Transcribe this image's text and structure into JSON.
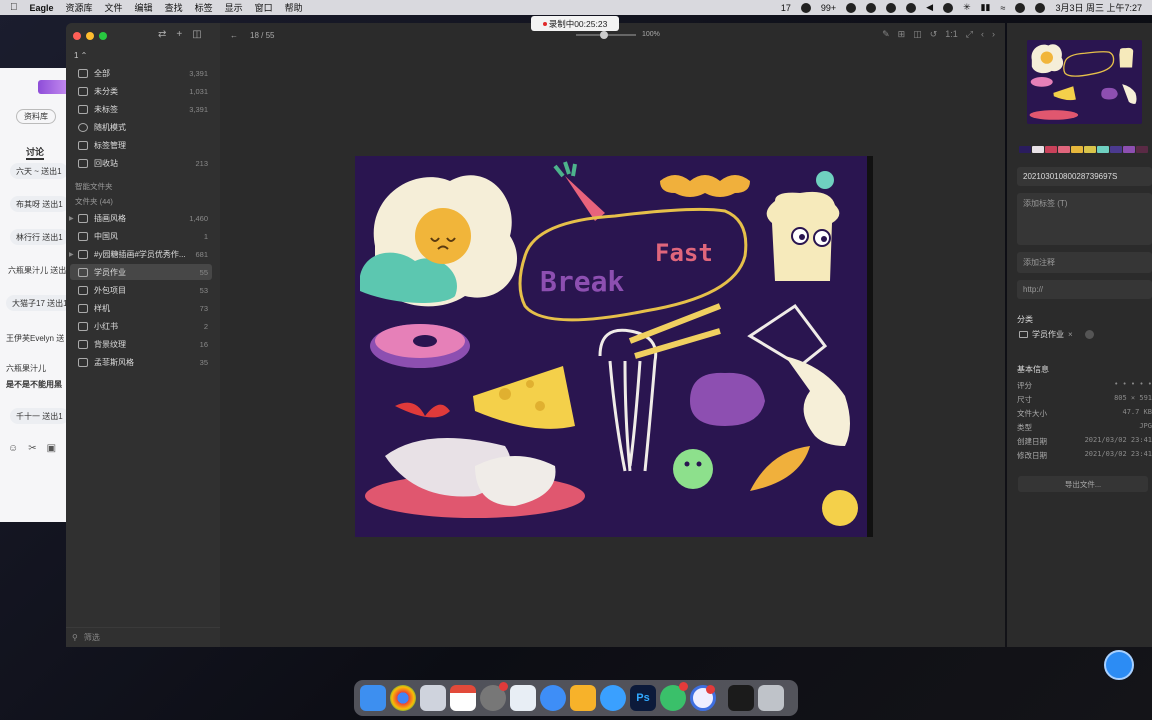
{
  "menubar": {
    "app_name": "Eagle",
    "items": [
      "资源库",
      "文件",
      "编辑",
      "查找",
      "标签",
      "显示",
      "窗口",
      "帮助"
    ],
    "status_count": "17",
    "wechat_badge": "99+",
    "datetime": "3月3日 周三 上午7:27"
  },
  "recording": {
    "label": "录制中00:25:23"
  },
  "background_app": {
    "library_button": "资料库",
    "discussion_tab": "讨论",
    "messages": [
      "六天 ~ 送出1",
      "布其呀 送出1",
      "林行行 送出1",
      "六瓶果汁儿 送出",
      "大猫子17 送出1",
      "王伊芙Evelyn 送",
      "六瓶果汁儿",
      "是不是不能用黑",
      "千十一 送出1"
    ]
  },
  "sidebar": {
    "account": "1 ⌃",
    "items": [
      {
        "label": "全部",
        "count": "3,391"
      },
      {
        "label": "未分类",
        "count": "1,031"
      },
      {
        "label": "未标签",
        "count": "3,391"
      },
      {
        "label": "随机模式",
        "count": ""
      },
      {
        "label": "标签管理",
        "count": ""
      },
      {
        "label": "回收站",
        "count": "213"
      }
    ],
    "smart_folders_title": "智能文件夹",
    "folders_title": "文件夹 (44)",
    "folders": [
      {
        "label": "插画风格",
        "count": "1,460"
      },
      {
        "label": "中国风",
        "count": "1"
      },
      {
        "label": "#y园糖插画#学员优秀作...",
        "count": "681"
      },
      {
        "label": "学员作业",
        "count": "55"
      },
      {
        "label": "外包项目",
        "count": "53"
      },
      {
        "label": "样机",
        "count": "73"
      },
      {
        "label": "小红书",
        "count": "2"
      },
      {
        "label": "背景纹理",
        "count": "16"
      },
      {
        "label": "孟菲斯风格",
        "count": "35"
      }
    ],
    "filter_placeholder": "筛选"
  },
  "viewer": {
    "position": "18 / 55",
    "zoom": "100%"
  },
  "artwork": {
    "text_line1": "Break",
    "text_line2": "Fast"
  },
  "inspector": {
    "swatches": [
      "#2a1c5e",
      "#e8e1e6",
      "#c9415a",
      "#e0667c",
      "#e6b73c",
      "#d9c44a",
      "#6fd0c0",
      "#4b3a8f",
      "#8d4fb1",
      "#5a2a45",
      "#3a3030"
    ],
    "filename": "20210301080028739697S",
    "tag_placeholder": "添加标签 (T)",
    "note_placeholder": "添加注释",
    "url_placeholder": "http://",
    "category_title": "分类",
    "category_value": "学员作业",
    "basic_info_title": "基本信息",
    "info": [
      {
        "key": "评分",
        "value": "• • • • •"
      },
      {
        "key": "尺寸",
        "value": "805 × 591"
      },
      {
        "key": "文件大小",
        "value": "47.7 KB"
      },
      {
        "key": "类型",
        "value": "JPG"
      },
      {
        "key": "创建日期",
        "value": "2021/03/02 23:41"
      },
      {
        "key": "修改日期",
        "value": "2021/03/02 23:41"
      }
    ],
    "export_label": "导出文件..."
  }
}
